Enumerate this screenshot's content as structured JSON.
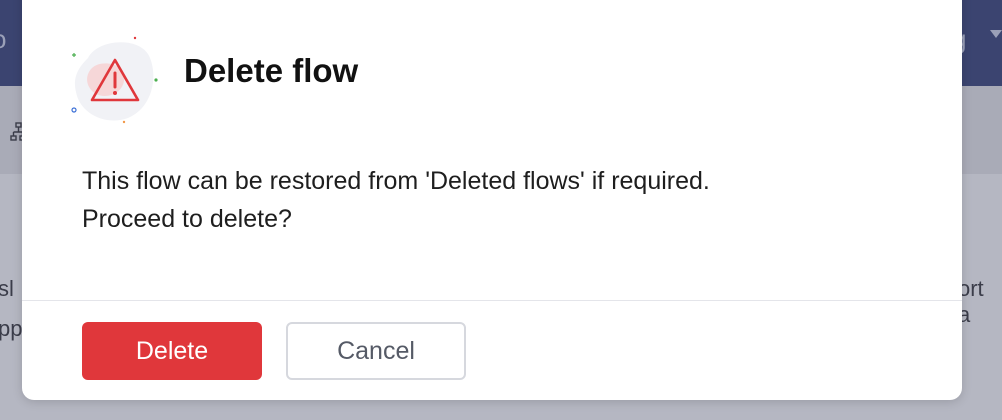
{
  "background": {
    "header_left_text": "o",
    "header_right_text": "g",
    "body_left_lines": [
      "sl",
      "pp"
    ],
    "body_right_lines": [
      "ort a"
    ]
  },
  "dialog": {
    "title": "Delete flow",
    "message_lines": [
      "This flow can be restored from 'Deleted flows' if required.",
      "Proceed to delete?"
    ],
    "icon": "warning-triangle-icon",
    "delete_label": "Delete",
    "cancel_label": "Cancel"
  },
  "colors": {
    "header_bg": "#3b4470",
    "overlay_bg": "#b5b7c2",
    "danger": "#e0373b",
    "warning_icon": "#e0373b",
    "dialog_bg": "#ffffff"
  }
}
